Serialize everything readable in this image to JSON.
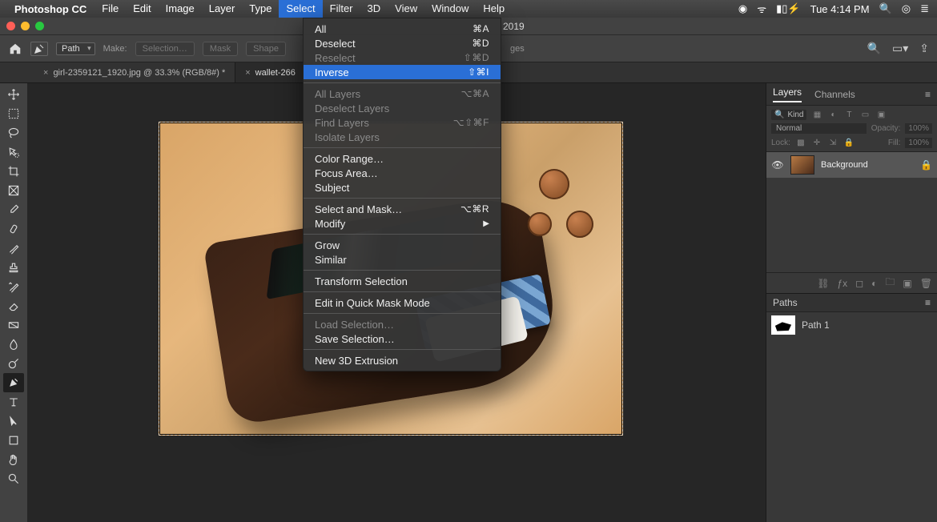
{
  "menubar": {
    "app": "Photoshop CC",
    "items": [
      "File",
      "Edit",
      "Image",
      "Layer",
      "Type",
      "Select",
      "Filter",
      "3D",
      "View",
      "Window",
      "Help"
    ],
    "selected": "Select",
    "clock": "Tue 4:14 PM"
  },
  "window": {
    "title_suffix": "2019"
  },
  "options": {
    "mode": "Path",
    "make_label": "Make:",
    "btn_selection": "Selection…",
    "btn_mask": "Mask",
    "btn_shape": "Shape",
    "btn_ges": "ges"
  },
  "tabs": {
    "t1": "girl-2359121_1920.jpg @ 33.3% (RGB/8#) *",
    "t2": "wallet-266"
  },
  "select_menu": {
    "all": "All",
    "all_sc": "⌘A",
    "deselect": "Deselect",
    "deselect_sc": "⌘D",
    "reselect": "Reselect",
    "reselect_sc": "⇧⌘D",
    "inverse": "Inverse",
    "inverse_sc": "⇧⌘I",
    "all_layers": "All Layers",
    "all_layers_sc": "⌥⌘A",
    "deselect_layers": "Deselect Layers",
    "find_layers": "Find Layers",
    "find_layers_sc": "⌥⇧⌘F",
    "isolate_layers": "Isolate Layers",
    "color_range": "Color Range…",
    "focus_area": "Focus Area…",
    "subject": "Subject",
    "select_mask": "Select and Mask…",
    "select_mask_sc": "⌥⌘R",
    "modify": "Modify",
    "grow": "Grow",
    "similar": "Similar",
    "transform": "Transform Selection",
    "quickmask": "Edit in Quick Mask Mode",
    "load": "Load Selection…",
    "save": "Save Selection…",
    "extrusion": "New 3D Extrusion"
  },
  "panels": {
    "layers_tab": "Layers",
    "channels_tab": "Channels",
    "kind_label": "Kind",
    "blend": "Normal",
    "opacity_label": "Opacity:",
    "opacity_val": "100%",
    "lock_label": "Lock:",
    "fill_label": "Fill:",
    "fill_val": "100%",
    "layer_name": "Background",
    "paths_tab": "Paths",
    "path_name": "Path 1"
  },
  "icons": {
    "search": "⌕"
  }
}
